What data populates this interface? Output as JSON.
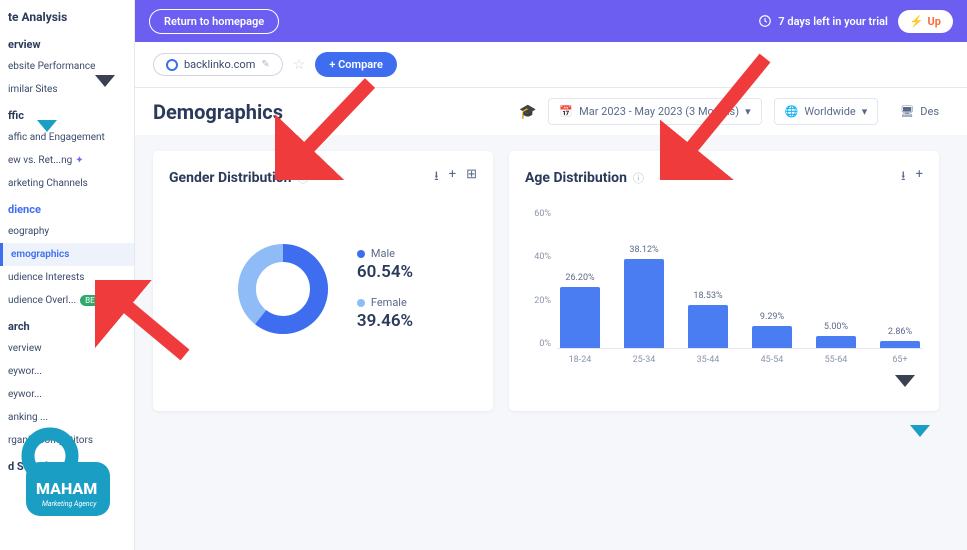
{
  "sidebar": {
    "title": "te Analysis",
    "groups": [
      {
        "head": "erview",
        "items": [
          {
            "label": "ebsite Performance"
          },
          {
            "label": "imilar Sites"
          }
        ]
      },
      {
        "head": "ffic",
        "items": [
          {
            "label": "affic and Engagement"
          },
          {
            "label": "ew vs. Ret...ng",
            "diamond": true
          },
          {
            "label": "arketing Channels"
          }
        ]
      },
      {
        "head": "dience",
        "blue": true,
        "items": [
          {
            "label": "eography"
          },
          {
            "label": "emographics",
            "active": true
          },
          {
            "label": "udience Interests"
          },
          {
            "label": "udience Overl...",
            "beta": "BETA",
            "diamond": true
          }
        ]
      },
      {
        "head": "arch",
        "items": [
          {
            "label": "verview"
          },
          {
            "label": "eywor..."
          },
          {
            "label": "eywor..."
          },
          {
            "label": "anking ..."
          },
          {
            "label": "rganic Competitors"
          }
        ]
      },
      {
        "head": "d Search",
        "items": []
      }
    ]
  },
  "topbar": {
    "return": "Return to homepage",
    "trial": "7 days left in your trial",
    "upgrade": "Up"
  },
  "sitebar": {
    "domain": "backlinko.com",
    "compare": "Compare"
  },
  "filters": {
    "title": "Demographics",
    "date": "Mar 2023 - May 2023 (3 Months)",
    "geo": "Worldwide",
    "device": "Des"
  },
  "gender": {
    "title": "Gender Distribution",
    "male_label": "Male",
    "male_value": "60.54%",
    "female_label": "Female",
    "female_value": "39.46%",
    "colors": {
      "male": "#3e6df0",
      "female": "#8fbcf6"
    }
  },
  "age": {
    "title": "Age Distribution",
    "ylabels": [
      "60%",
      "40%",
      "20%",
      "0%"
    ]
  },
  "chart_data": [
    {
      "type": "pie",
      "title": "Gender Distribution",
      "categories": [
        "Male",
        "Female"
      ],
      "values": [
        60.54,
        39.46
      ]
    },
    {
      "type": "bar",
      "title": "Age Distribution",
      "categories": [
        "18-24",
        "25-34",
        "35-44",
        "45-54",
        "55-64",
        "65+"
      ],
      "values": [
        26.2,
        38.12,
        18.53,
        9.29,
        5.0,
        2.86
      ],
      "ylabel": "%",
      "ylim": [
        0,
        60
      ]
    }
  ]
}
